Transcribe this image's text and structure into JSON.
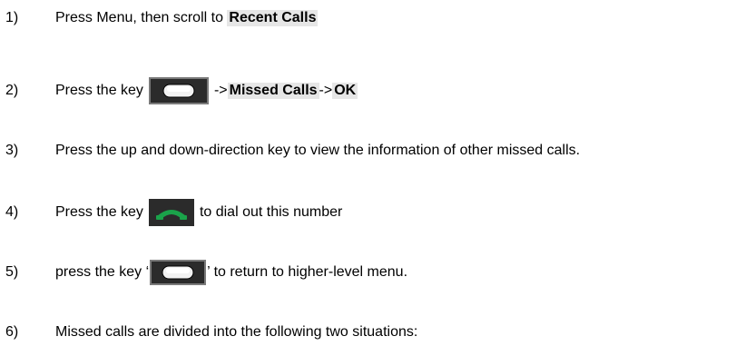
{
  "steps": [
    {
      "num": "1)",
      "pre": "Press Menu, then scroll to ",
      "hl": "Recent Calls"
    },
    {
      "num": "2)",
      "pre": "Press the key",
      "icon": "soft-key-icon",
      "arrow1": "->",
      "hl1": "Missed Calls",
      "arrow2": "->",
      "hl2": "OK"
    },
    {
      "num": "3)",
      "text": "Press the up and down-direction key to view the information of other missed calls."
    },
    {
      "num": "4)",
      "pre": "Press the key",
      "icon": "call-key-icon",
      "post": "to dial out this number"
    },
    {
      "num": "5)",
      "pre": "press the key ‘",
      "icon": "soft-key-icon",
      "post": "’ to return to higher-level menu."
    },
    {
      "num": "6)",
      "text": "Missed calls are divided into the following two situations:"
    }
  ],
  "colors": {
    "highlight": "#e6e6e6",
    "call_key_green": "#1aa34a",
    "key_dark": "#2b2b2b"
  }
}
